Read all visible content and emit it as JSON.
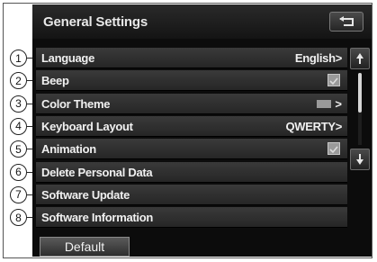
{
  "header": {
    "title": "General Settings",
    "back_icon": "return-arrow-icon"
  },
  "rows": [
    {
      "label": "Language",
      "value": "English>",
      "control": "value"
    },
    {
      "label": "Beep",
      "control": "checkbox",
      "checked": true
    },
    {
      "label": "Color Theme",
      "control": "theme",
      "arrow": ">"
    },
    {
      "label": "Keyboard Layout",
      "value": "QWERTY>",
      "control": "value"
    },
    {
      "label": "Animation",
      "control": "checkbox",
      "checked": true
    },
    {
      "label": "Delete Personal Data",
      "control": "none"
    },
    {
      "label": "Software Update",
      "control": "none"
    },
    {
      "label": "Software Information",
      "control": "none"
    }
  ],
  "callouts": [
    "1",
    "2",
    "3",
    "4",
    "5",
    "6",
    "7",
    "8"
  ],
  "scrollbar": {
    "up_icon": "scroll-up-icon",
    "down_icon": "scroll-down-icon",
    "visible_fraction": 0.55,
    "position_fraction": 0.0
  },
  "footer": {
    "default_label": "Default"
  },
  "colors": {
    "screen_bg": "#0c0c0c",
    "row_bg": "#303030",
    "text": "#f0f0f0",
    "checkbox": "#9a9a9a"
  }
}
